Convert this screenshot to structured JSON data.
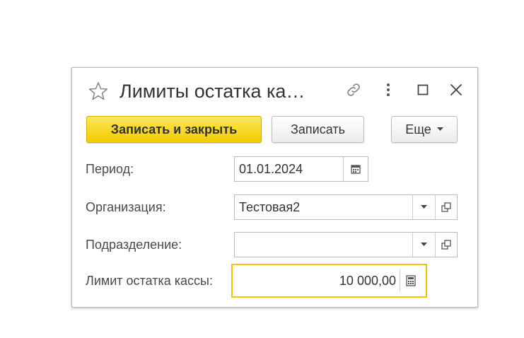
{
  "window": {
    "title": "Лимиты остатка ка…",
    "icons": [
      "star-icon",
      "link-icon",
      "more-vertical-icon",
      "maximize-icon",
      "close-icon"
    ]
  },
  "toolbar": {
    "save_close_label": "Записать и закрыть",
    "save_label": "Записать",
    "more_label": "Еще"
  },
  "form": {
    "period": {
      "label": "Период:",
      "value": "01.01.2024"
    },
    "organization": {
      "label": "Организация:",
      "value": "Тестовая2"
    },
    "department": {
      "label": "Подразделение:",
      "value": ""
    },
    "cash_limit": {
      "label": "Лимит остатка кассы:",
      "value": "10 000,00"
    }
  },
  "colors": {
    "primary_button": "#f2cc00",
    "focus_border": "#f5c400",
    "text": "#333333"
  }
}
